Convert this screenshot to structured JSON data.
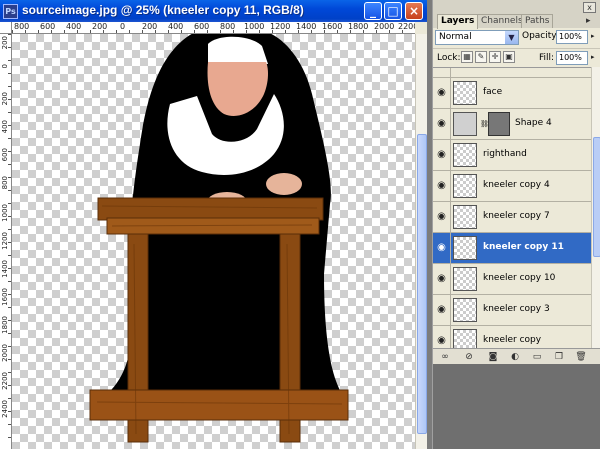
{
  "document": {
    "title": "sourceimage.jpg @ 25% (kneeler copy 11, RGB/8)",
    "ps_icon": "ps-icon",
    "window_buttons": {
      "minimize": "_",
      "maximize": "□",
      "close": "×"
    },
    "ruler_top_labels": [
      "800",
      "600",
      "400",
      "200",
      "0",
      "200",
      "400",
      "600",
      "800",
      "1000",
      "1200",
      "1400",
      "1600",
      "1800",
      "2000",
      "2200"
    ],
    "ruler_left_labels": [
      "200",
      "0",
      "200",
      "400",
      "600",
      "800",
      "1000",
      "1200",
      "1400",
      "1600",
      "1800",
      "2000",
      "2200",
      "2400"
    ]
  },
  "layers_panel": {
    "tabs": [
      {
        "label": "Layers",
        "active": true
      },
      {
        "label": "Channels",
        "active": false
      },
      {
        "label": "Paths",
        "active": false
      }
    ],
    "close_glyph": "x",
    "menu_glyph": "▸",
    "blend_mode": "Normal",
    "opacity_label": "Opacity:",
    "opacity_value": "100%",
    "lock_label": "Lock:",
    "fill_label": "Fill:",
    "fill_value": "100%",
    "layers": [
      {
        "name": "",
        "selected": false
      },
      {
        "name": "face",
        "selected": false
      },
      {
        "name": "Shape 4",
        "selected": false,
        "shape": true
      },
      {
        "name": "righthand",
        "selected": false
      },
      {
        "name": "kneeler copy 4",
        "selected": false
      },
      {
        "name": "kneeler copy 7",
        "selected": false
      },
      {
        "name": "kneeler copy 11",
        "selected": true
      },
      {
        "name": "kneeler copy 10",
        "selected": false
      },
      {
        "name": "kneeler copy 3",
        "selected": false
      },
      {
        "name": "kneeler copy",
        "selected": false
      }
    ],
    "bottom_icons": [
      "link-icon",
      "fx-icon",
      "mask-icon",
      "adjustment-icon",
      "folder-icon",
      "new-layer-icon",
      "trash-icon"
    ]
  },
  "colors": {
    "titlebar": "#0054e3",
    "selected_row": "#316ac5",
    "habit": "#000000",
    "wood": "#8a4a12"
  }
}
